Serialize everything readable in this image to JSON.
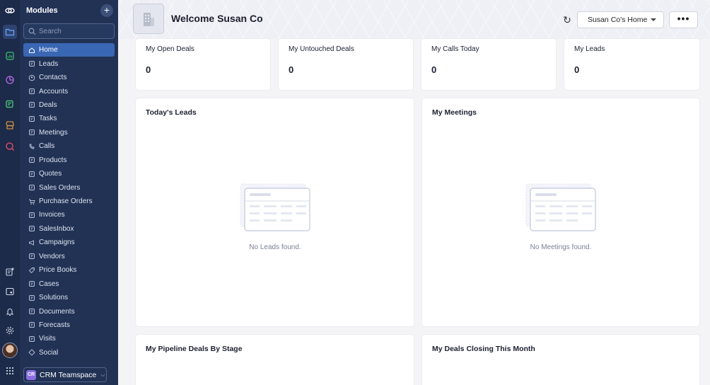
{
  "sidebar": {
    "title": "Modules",
    "add_label": "+",
    "search_placeholder": "Search",
    "items": [
      {
        "label": "Home",
        "icon": "home-icon",
        "active": true
      },
      {
        "label": "Leads",
        "icon": "leads-icon"
      },
      {
        "label": "Contacts",
        "icon": "contacts-icon"
      },
      {
        "label": "Accounts",
        "icon": "accounts-icon"
      },
      {
        "label": "Deals",
        "icon": "deals-icon"
      },
      {
        "label": "Tasks",
        "icon": "tasks-icon"
      },
      {
        "label": "Meetings",
        "icon": "meetings-icon"
      },
      {
        "label": "Calls",
        "icon": "phone-icon"
      },
      {
        "label": "Products",
        "icon": "products-icon"
      },
      {
        "label": "Quotes",
        "icon": "quotes-icon"
      },
      {
        "label": "Sales Orders",
        "icon": "sales-orders-icon"
      },
      {
        "label": "Purchase Orders",
        "icon": "cart-icon"
      },
      {
        "label": "Invoices",
        "icon": "invoices-icon"
      },
      {
        "label": "SalesInbox",
        "icon": "inbox-icon"
      },
      {
        "label": "Campaigns",
        "icon": "megaphone-icon"
      },
      {
        "label": "Vendors",
        "icon": "vendors-icon"
      },
      {
        "label": "Price Books",
        "icon": "tag-icon"
      },
      {
        "label": "Cases",
        "icon": "cases-icon"
      },
      {
        "label": "Solutions",
        "icon": "solutions-icon"
      },
      {
        "label": "Documents",
        "icon": "documents-icon"
      },
      {
        "label": "Forecasts",
        "icon": "forecasts-icon"
      },
      {
        "label": "Visits",
        "icon": "visits-icon"
      },
      {
        "label": "Social",
        "icon": "social-icon"
      }
    ],
    "teamspace": {
      "badge": "CR",
      "label": "CRM Teamspace"
    }
  },
  "header": {
    "welcome": "Welcome Susan Co",
    "home_selector": "Susan Co's Home",
    "more_label": "•••",
    "refresh_icon": "refresh-icon"
  },
  "stats": [
    {
      "title": "My Open Deals",
      "value": "0"
    },
    {
      "title": "My Untouched Deals",
      "value": "0"
    },
    {
      "title": "My Calls Today",
      "value": "0"
    },
    {
      "title": "My Leads",
      "value": "0"
    }
  ],
  "panels": {
    "leads": {
      "title": "Today's Leads",
      "empty": "No Leads found."
    },
    "meetings": {
      "title": "My Meetings",
      "empty": "No Meetings found."
    },
    "pipeline": {
      "title": "My Pipeline Deals By Stage"
    },
    "closing": {
      "title": "My Deals Closing This Month"
    }
  },
  "colors": {
    "rail": "#1d2b4a",
    "sidebar": "#213255",
    "active_item": "#3a67b4",
    "background": "#f4f4f7"
  }
}
